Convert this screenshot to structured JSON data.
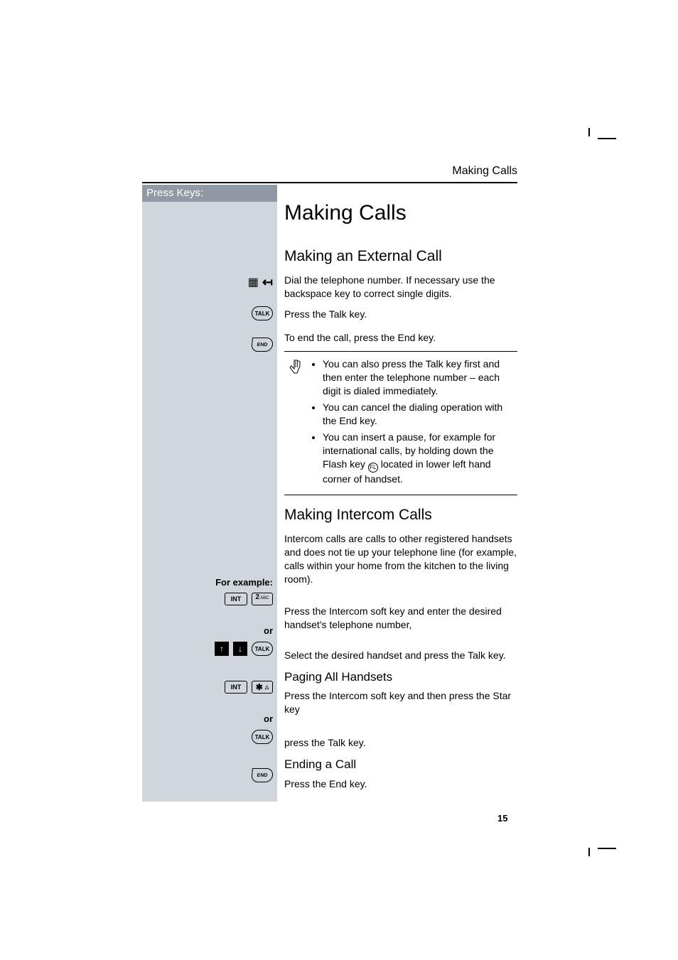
{
  "header": {
    "section": "Making Calls"
  },
  "sidebar": {
    "title": "Press Keys:"
  },
  "keys": {
    "talk": "TALK",
    "end": "END",
    "int": "INT",
    "two": "2",
    "two_sup": "ABC",
    "star": "✱",
    "flash_label": "FL"
  },
  "labels": {
    "for_example": "For example:",
    "or1": "or",
    "or2": "or"
  },
  "main": {
    "title": "Making Calls",
    "h2a": "Making an External Call",
    "p1": "Dial the telephone number. If necessary use the backspace key to correct single digits.",
    "p2": "Press the Talk key.",
    "p3": "To end the call, press the End key.",
    "notes": {
      "n1a": "You can also press the Talk key first",
      "n1b": " and then enter the telephone number  – each digit is dialed immediately.",
      "n2": "You can cancel the dialing operation with the End key.",
      "n3a": "You can insert a pause, for example for international calls, by holding down the Flash key ",
      "n3b": " located in lower left hand corner of handset."
    },
    "h2b": "Making Intercom Calls",
    "p4": "Intercom calls are calls to other registered handsets and does not tie up your telephone line (for example, calls within your home from the kitchen to the living room).",
    "p5": "Press the Intercom soft key and enter the desired handset's telephone number,",
    "p6": "Select the desired handset and press the Talk key.",
    "h3a": "Paging All Handsets",
    "p7": "Press the Intercom soft key and then press the Star key",
    "p8": "press the Talk key.",
    "h3b": "Ending a Call",
    "p9": "Press the End key."
  },
  "page_number": "15"
}
